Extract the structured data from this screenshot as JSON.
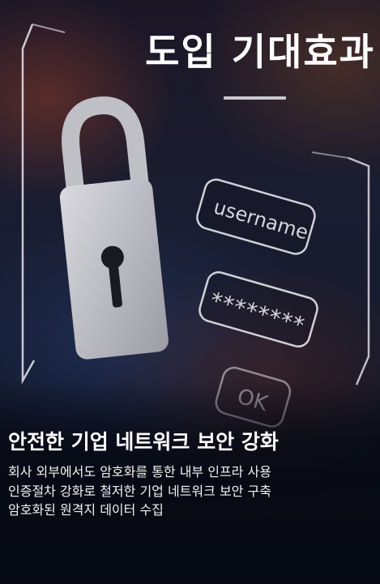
{
  "hero": {
    "title": "도입 기대효과"
  },
  "graphic": {
    "username_field": "username",
    "password_field": "********",
    "ok_button": "OK"
  },
  "content": {
    "subtitle": "안전한 기업 네트워크 보안 강화",
    "lines": [
      "회사 외부에서도 암호화를 통한 내부 인프라 사용",
      "인증절차 강화로 철저한 기업 네트워크 보안 구축",
      "암호화된 원격지 데이터 수집"
    ]
  }
}
